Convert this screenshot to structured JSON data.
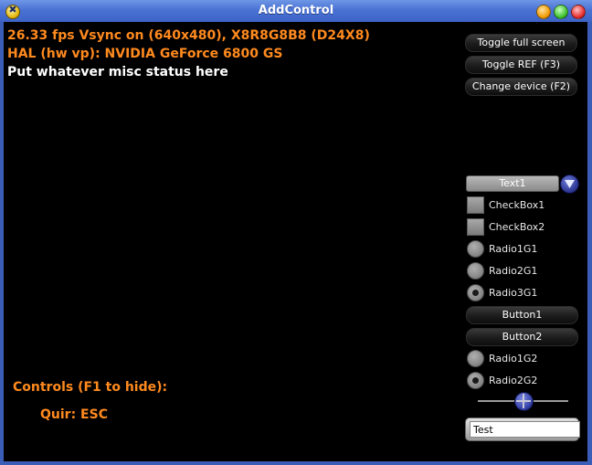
{
  "window": {
    "title": "AddControl",
    "app_icon_glyph": "✖"
  },
  "status": {
    "line1": "26.33 fps Vsync on (640x480), X8R8G8B8 (D24X8)",
    "line2": "HAL (hw vp): NVIDIA GeForce 6800 GS",
    "line3": "Put whatever misc status here"
  },
  "controls_help": {
    "title": "Controls (F1 to hide):",
    "quit": "Quir: ESC"
  },
  "buttons": {
    "toggle_full_screen": "Toggle full screen",
    "toggle_ref": "Toggle REF (F3)",
    "change_device": "Change device (F2)",
    "button1": "Button1",
    "button2": "Button2"
  },
  "combo": {
    "selected": "Text1"
  },
  "checkboxes": {
    "cb1": "CheckBox1",
    "cb2": "CheckBox2"
  },
  "radios": {
    "r1g1": "Radio1G1",
    "r2g1": "Radio2G1",
    "r3g1": "Radio3G1",
    "r1g2": "Radio1G2",
    "r2g2": "Radio2G2"
  },
  "slider": {
    "value": 0.5
  },
  "edit": {
    "value": "Test"
  },
  "colors": {
    "status_orange": "#ff8a1e",
    "title_blue": "#4a72d4"
  }
}
